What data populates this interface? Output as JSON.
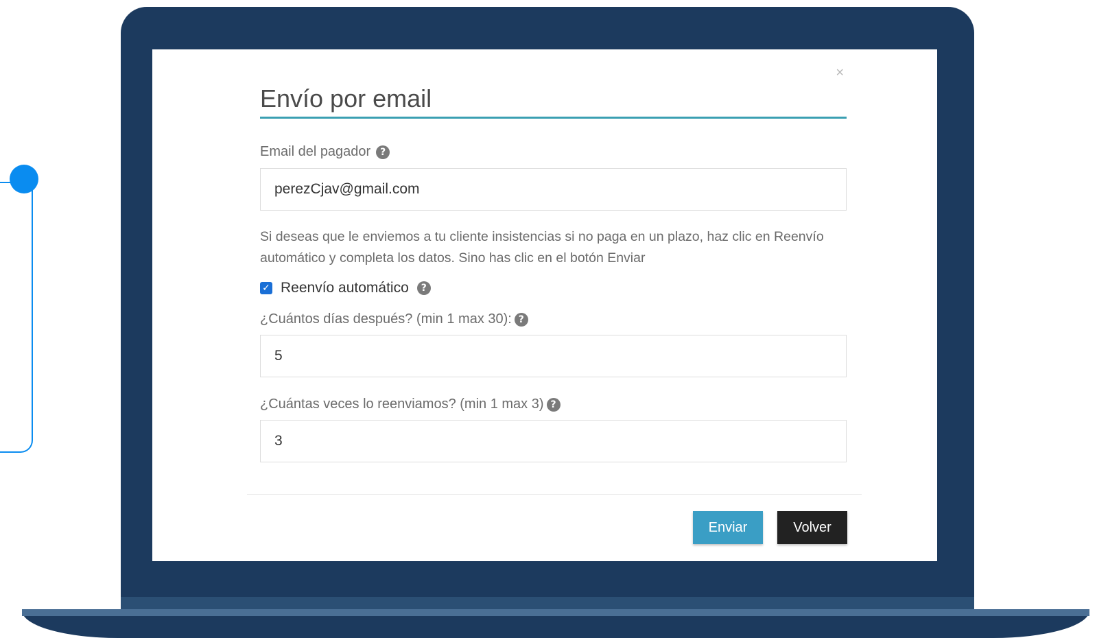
{
  "modal": {
    "title": "Envío por email",
    "close_symbol": "×",
    "email_label": "Email del pagador",
    "email_value": "perezCjav@gmail.com",
    "info_text": "Si deseas que le enviemos a tu cliente insistencias si no paga en un plazo, haz clic en Reenvío automático y completa los datos. Sino has clic en el botón Enviar",
    "auto_resend_label": "Reenvío automático",
    "auto_resend_checked": true,
    "days_label": "¿Cuántos días después? (min 1 max 30):",
    "days_value": "5",
    "times_label": "¿Cuántas veces lo reenviamos? (min 1 max 3)",
    "times_value": "3",
    "send_button": "Enviar",
    "back_button": "Volver"
  },
  "icons": {
    "help": "question-circle-icon",
    "check": "checkmark-icon",
    "close": "close-icon"
  },
  "colors": {
    "accent": "#3a9fb2",
    "send_button": "#3a9ec5",
    "back_button": "#222222",
    "laptop": "#1c3a5e",
    "connector": "#0a8cf0",
    "checkbox": "#1a6fd6"
  }
}
